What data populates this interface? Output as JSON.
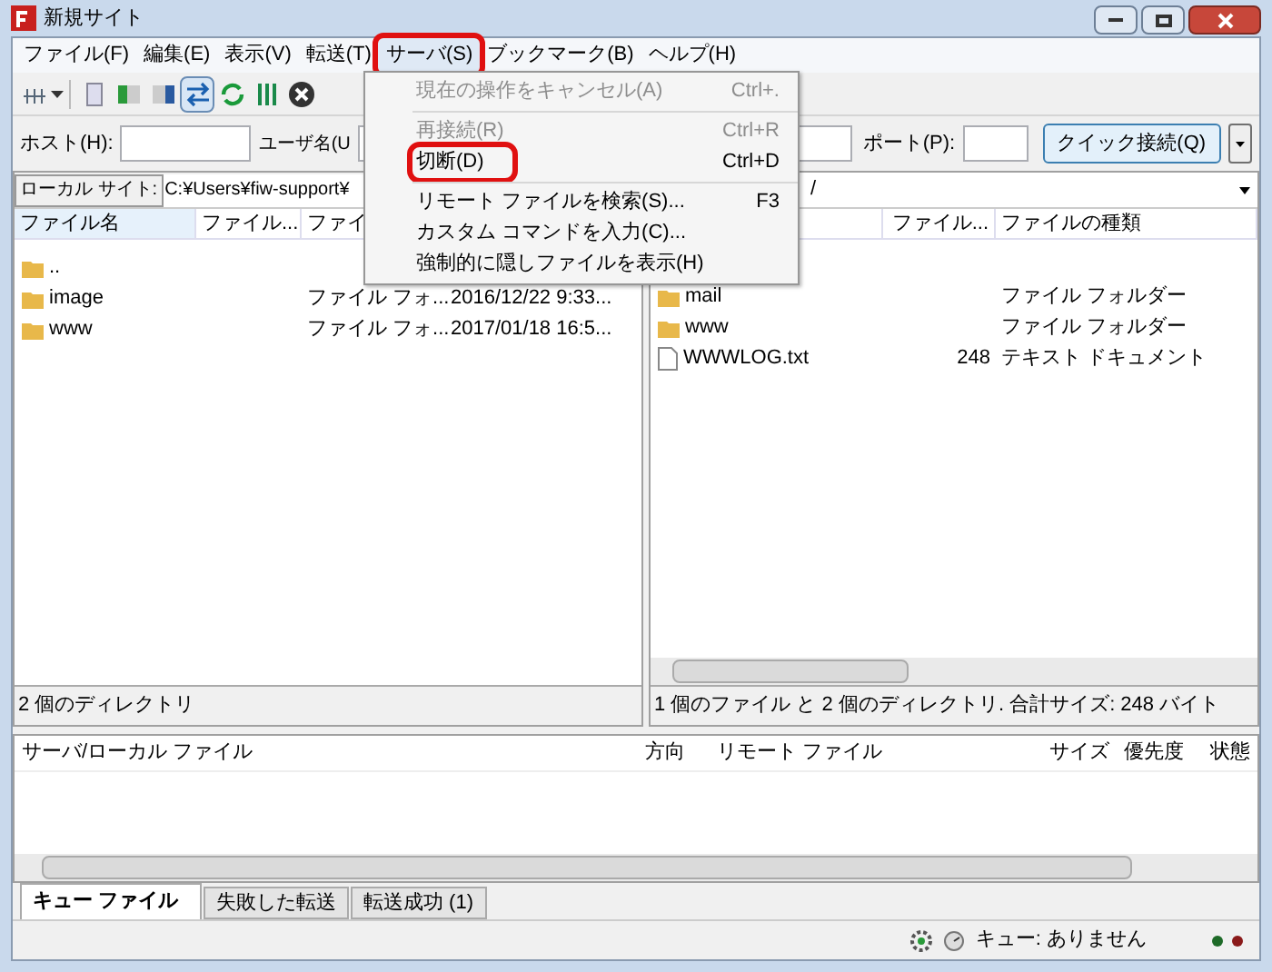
{
  "window": {
    "title": "新規サイト"
  },
  "menu_bar": [
    {
      "label": "ファイル(F)",
      "selected": false,
      "annotated": false
    },
    {
      "label": "編集(E)",
      "selected": false,
      "annotated": false
    },
    {
      "label": "表示(V)",
      "selected": false,
      "annotated": false
    },
    {
      "label": "転送(T)",
      "selected": false,
      "annotated": false
    },
    {
      "label": "サーバ(S)",
      "selected": true,
      "annotated": true
    },
    {
      "label": "ブックマーク(B)",
      "selected": false,
      "annotated": false
    },
    {
      "label": "ヘルプ(H)",
      "selected": false,
      "annotated": false
    }
  ],
  "dropdown": [
    {
      "kind": "item",
      "label": "現在の操作をキャンセル(A)",
      "shortcut": "Ctrl+.",
      "disabled": true,
      "annotated": false
    },
    {
      "kind": "separator"
    },
    {
      "kind": "item",
      "label": "再接続(R)",
      "shortcut": "Ctrl+R",
      "disabled": true,
      "annotated": false
    },
    {
      "kind": "item",
      "label": "切断(D)",
      "shortcut": "Ctrl+D",
      "disabled": false,
      "annotated": true
    },
    {
      "kind": "separator"
    },
    {
      "kind": "item",
      "label": "リモート ファイルを検索(S)...",
      "shortcut": "F3",
      "disabled": false,
      "annotated": false
    },
    {
      "kind": "item",
      "label": "カスタム コマンドを入力(C)...",
      "disabled": false,
      "annotated": false
    },
    {
      "kind": "item",
      "label": "強制的に隠しファイルを表示(H)",
      "disabled": false,
      "annotated": false
    }
  ],
  "quick_connect": {
    "host_label": "ホスト(H):",
    "user_label": "ユーザ名(U",
    "port_label": "ポート(P):",
    "button": "クイック接続(Q)"
  },
  "local_site": {
    "label": "ローカル サイト:",
    "path": "C:¥Users¥fiw-support¥"
  },
  "remote_site": {
    "path": "/"
  },
  "local_files": {
    "columns": [
      "ファイル名",
      "ファイル...",
      "ファイ"
    ],
    "rows": [
      {
        "name": "..",
        "type": "",
        "date": ""
      },
      {
        "name": "image",
        "type": "ファイル フォ...",
        "date": "2016/12/22 9:33..."
      },
      {
        "name": "www",
        "type": "ファイル フォ...",
        "date": "2017/01/18 16:5..."
      }
    ],
    "status": "2 個のディレクトリ"
  },
  "remote_files": {
    "columns": [
      "ファイル...",
      "ファイルの種類"
    ],
    "rows": [
      {
        "kind": "folder",
        "name": "mail",
        "size": "",
        "type": "ファイル フォルダー"
      },
      {
        "kind": "folder",
        "name": "www",
        "size": "",
        "type": "ファイル フォルダー"
      },
      {
        "kind": "file",
        "name": "WWWLOG.txt",
        "size": "248",
        "type": "テキスト ドキュメント"
      }
    ],
    "status": "1 個のファイル と 2 個のディレクトリ. 合計サイズ: 248 バイト"
  },
  "queue": {
    "columns": [
      "サーバ/ローカル ファイル",
      "方向",
      "リモート ファイル",
      "サイズ",
      "優先度",
      "状態"
    ]
  },
  "tabs": [
    {
      "label": "キュー ファイル",
      "selected": true
    },
    {
      "label": "失敗した転送",
      "selected": false
    },
    {
      "label": "転送成功 (1)",
      "selected": false
    }
  ],
  "status_bar": {
    "queue": "キュー: ありません"
  }
}
